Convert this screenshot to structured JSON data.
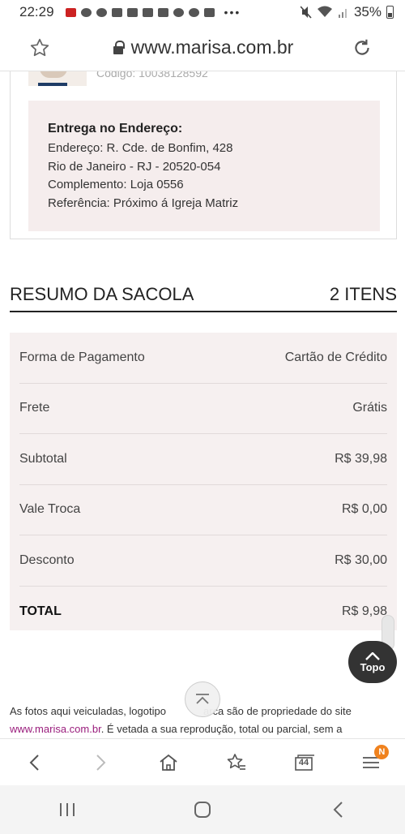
{
  "status_bar": {
    "time": "22:29",
    "battery": "35%"
  },
  "browser": {
    "url": "www.marisa.com.br"
  },
  "product": {
    "code": "Código: 10038128592"
  },
  "delivery": {
    "title": "Entrega no Endereço:",
    "lines": [
      "Endereço: R. Cde. de Bonfim, 428",
      "Rio de Janeiro - RJ - 20520-054",
      "Complemento: Loja 0556",
      "Referência: Próximo á Igreja Matriz"
    ]
  },
  "summary": {
    "title": "RESUMO DA SACOLA",
    "count": "2 ITENS",
    "rows": [
      {
        "label": "Forma de Pagamento",
        "value": "Cartão de Crédito"
      },
      {
        "label": "Frete",
        "value": "Grátis"
      },
      {
        "label": "Subtotal",
        "value": "R$ 39,98"
      },
      {
        "label": "Vale Troca",
        "value": "R$ 0,00"
      },
      {
        "label": "Desconto",
        "value": "R$ 30,00"
      },
      {
        "label": "TOTAL",
        "value": "R$ 9,98"
      }
    ]
  },
  "topo_button": {
    "label": "Topo"
  },
  "footer": {
    "line1": "As fotos aqui veiculadas, logotipo",
    "line1_end": "arca são de propriedade do site",
    "link": "www.marisa.com.br",
    "line2": ". É vetada a sua reprodução, total ou parcial, sem a"
  },
  "bottom_bar": {
    "tabs_count": "44",
    "menu_badge": "N"
  }
}
